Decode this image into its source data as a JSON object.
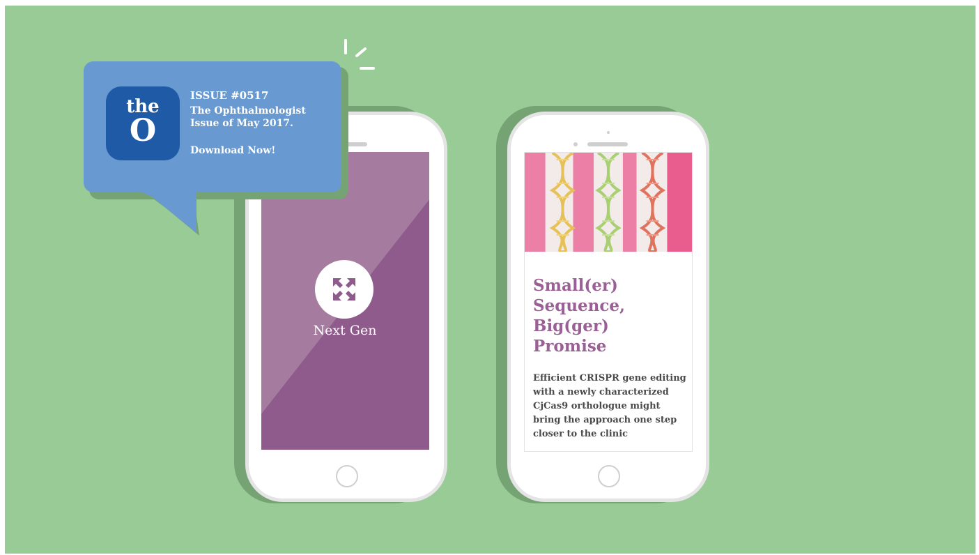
{
  "notification": {
    "app_icon_top": "the",
    "app_icon_bottom": "O",
    "issue": "ISSUE #0517",
    "line1": "The Ophthalmologist",
    "line2": "Issue of May 2017.",
    "cta": "Download Now!"
  },
  "left_phone": {
    "label": "Next Gen",
    "icon": "expand-arrows-icon"
  },
  "right_phone": {
    "title": "Small(er)\nSequence,\nBig(ger)\nPromise",
    "body": "Efficient CRISPR gene editing with a newly characterized CjCas9 orthologue might bring the approach one step closer to the clinic",
    "image": "dna-helix-illustration"
  },
  "colors": {
    "background": "#98cb95",
    "shadow": "#76a373",
    "bubble": "#6899d0",
    "app_icon": "#1f5aa6",
    "purple": "#8f5a8c",
    "purple_light": "#a57ca0",
    "title": "#9a6096"
  }
}
